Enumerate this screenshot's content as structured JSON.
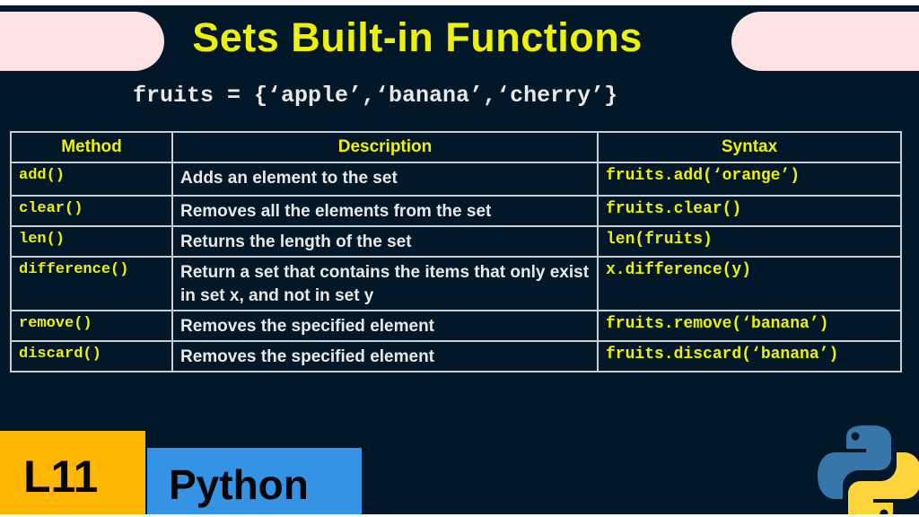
{
  "title": "Sets Built-in Functions",
  "code_example": "fruits = {‘apple’,‘banana’,‘cherry’}",
  "table": {
    "headers": [
      "Method",
      "Description",
      "Syntax"
    ],
    "rows": [
      {
        "method": "add()",
        "description": "Adds an element to the set",
        "syntax": "fruits.add(‘orange’)"
      },
      {
        "method": "clear()",
        "description": "Removes all the elements from the set",
        "syntax": "fruits.clear()"
      },
      {
        "method": "len()",
        "description": "Returns the length of the set",
        "syntax": "len(fruits)"
      },
      {
        "method": "difference()",
        "description": "Return a set that contains the items that only exist in set x, and not in set y",
        "syntax": "x.difference(y)"
      },
      {
        "method": "remove()",
        "description": "Removes the specified element",
        "syntax": "fruits.remove(‘banana’)"
      },
      {
        "method": "discard()",
        "description": "Removes the specified element",
        "syntax": "fruits.discard(‘banana’)"
      }
    ]
  },
  "badges": {
    "lesson": "L11",
    "language": "Python"
  },
  "logo": {
    "icon": "python-logo-icon",
    "colors": {
      "blue": "#3776ab",
      "yellow": "#ffd43b"
    }
  },
  "colors": {
    "background": "#021828",
    "accent_yellow": "#eef200",
    "pill_pink": "#fde3e4",
    "badge_orange": "#ffb703",
    "badge_blue": "#3493e5"
  }
}
